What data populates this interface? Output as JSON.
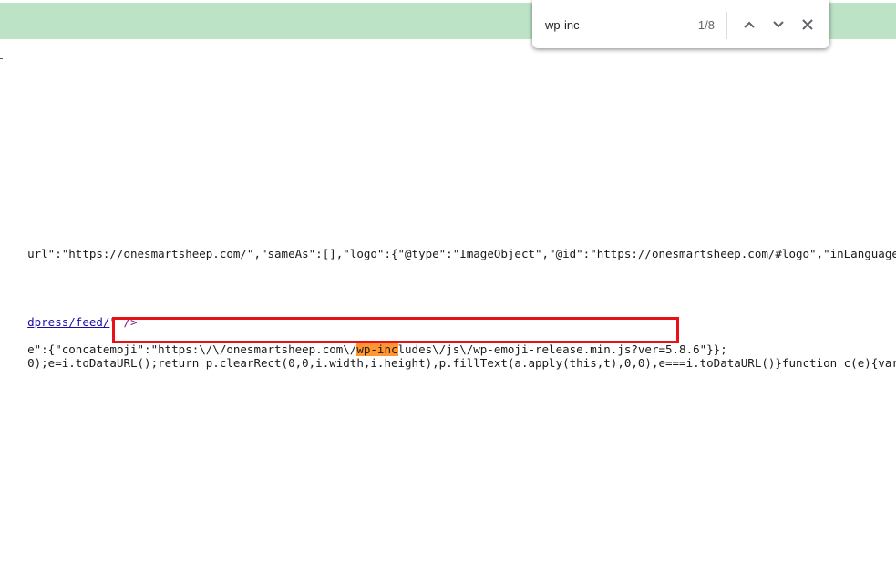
{
  "find_bar": {
    "query": "wp-inc",
    "match_count": "1/8",
    "prev_icon": "chevron-up-icon",
    "next_icon": "chevron-down-icon",
    "close_icon": "close-icon"
  },
  "code": {
    "line1_a": "url\":\"https://onesmartsheep.com/\",\"sameAs\":[],\"logo\":{\"@type\":\"ImageObject\",\"@id\":\"https://onesmartsheep.com/#logo\",\"inLanguage\":\"en-US\",\"",
    "line2_link": "dpress/feed/",
    "line2_tail": "\" />",
    "line3_a": "e\":{\"concatemoji\":\"https:\\/\\/onesmartsheep.com\\/",
    "line3_match": "wp-inc",
    "line3_b": "ludes\\/js\\/wp-emoji-release.min.js?ver=5.8.6\"}};",
    "line4_a": "0);e=i.toDataURL();return p.clearRect(0,0,i.width,i.height),p.fillText(a.apply(this,t),0,0),e===i.toDataURL()}function c(e){var t=a.create"
  },
  "colors": {
    "top_bar": "#bde3c7",
    "match_highlight": "#ff9632",
    "annotation_box": "#e8111a"
  }
}
